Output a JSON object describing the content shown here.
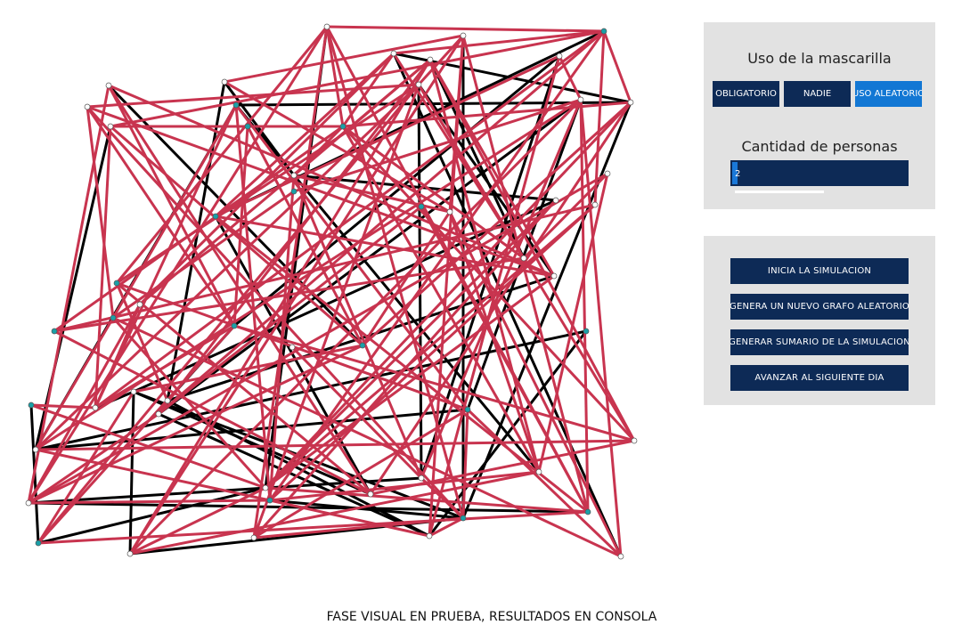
{
  "mask_panel": {
    "title": "Uso de la mascarilla",
    "options": [
      "OBLIGATORIO",
      "NADIE",
      "USO ALEATORIO"
    ],
    "selected": "USO ALEATORIO",
    "count_title": "Cantidad de personas",
    "count_value": "2"
  },
  "controls": {
    "start": "INICIA LA SIMULACION",
    "new_graph": "GENERA UN NUEVO GRAFO ALEATORIO",
    "summary": "GENERAR SUMARIO DE LA SIMULACION",
    "next_day": "AVANZAR AL SIGUIENTE DIA"
  },
  "footer": "FASE VISUAL EN PRUEBA, RESULTADOS EN CONSOLA",
  "graph": {
    "colors": {
      "edge_infected": "#c8344f",
      "edge_healthy": "#000000",
      "node_masked": "#1aa0a8",
      "node_unmasked": "#ffffff",
      "node_outline": "#555555"
    }
  }
}
